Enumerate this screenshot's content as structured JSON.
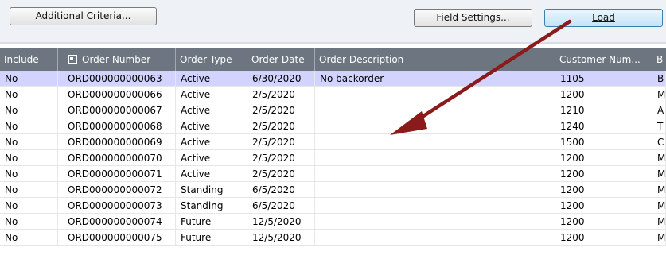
{
  "toolbar": {
    "additional_criteria_label": "Additional Criteria...",
    "field_settings_label": "Field Settings...",
    "load_label": "Load"
  },
  "table": {
    "headers": [
      "Include",
      "Order Number",
      "Order Type",
      "Order Date",
      "Order Description",
      "Customer Num...",
      "B"
    ],
    "rows": [
      {
        "include": "No",
        "order_number": "ORD000000000063",
        "order_type": "Active",
        "order_date": "6/30/2020",
        "description": "No backorder",
        "customer": "1105",
        "b": "B"
      },
      {
        "include": "No",
        "order_number": "ORD000000000066",
        "order_type": "Active",
        "order_date": "2/5/2020",
        "description": "",
        "customer": "1200",
        "b": "M"
      },
      {
        "include": "No",
        "order_number": "ORD000000000067",
        "order_type": "Active",
        "order_date": "2/5/2020",
        "description": "",
        "customer": "1210",
        "b": "A"
      },
      {
        "include": "No",
        "order_number": "ORD000000000068",
        "order_type": "Active",
        "order_date": "2/5/2020",
        "description": "",
        "customer": "1240",
        "b": "T"
      },
      {
        "include": "No",
        "order_number": "ORD000000000069",
        "order_type": "Active",
        "order_date": "2/5/2020",
        "description": "",
        "customer": "1500",
        "b": "C"
      },
      {
        "include": "No",
        "order_number": "ORD000000000070",
        "order_type": "Active",
        "order_date": "2/5/2020",
        "description": "",
        "customer": "1200",
        "b": "M"
      },
      {
        "include": "No",
        "order_number": "ORD000000000071",
        "order_type": "Active",
        "order_date": "2/5/2020",
        "description": "",
        "customer": "1200",
        "b": "M"
      },
      {
        "include": "No",
        "order_number": "ORD000000000072",
        "order_type": "Standing",
        "order_date": "6/5/2020",
        "description": "",
        "customer": "1200",
        "b": "M"
      },
      {
        "include": "No",
        "order_number": "ORD000000000073",
        "order_type": "Standing",
        "order_date": "6/5/2020",
        "description": "",
        "customer": "1200",
        "b": "M"
      },
      {
        "include": "No",
        "order_number": "ORD000000000074",
        "order_type": "Future",
        "order_date": "12/5/2020",
        "description": "",
        "customer": "1200",
        "b": "M"
      },
      {
        "include": "No",
        "order_number": "ORD000000000075",
        "order_type": "Future",
        "order_date": "12/5/2020",
        "description": "",
        "customer": "1200",
        "b": "M"
      }
    ]
  },
  "colors": {
    "header_bg": "#6d7680",
    "selected_row_bg": "#d3d3ff",
    "annotation_arrow": "#8b1a1a"
  }
}
